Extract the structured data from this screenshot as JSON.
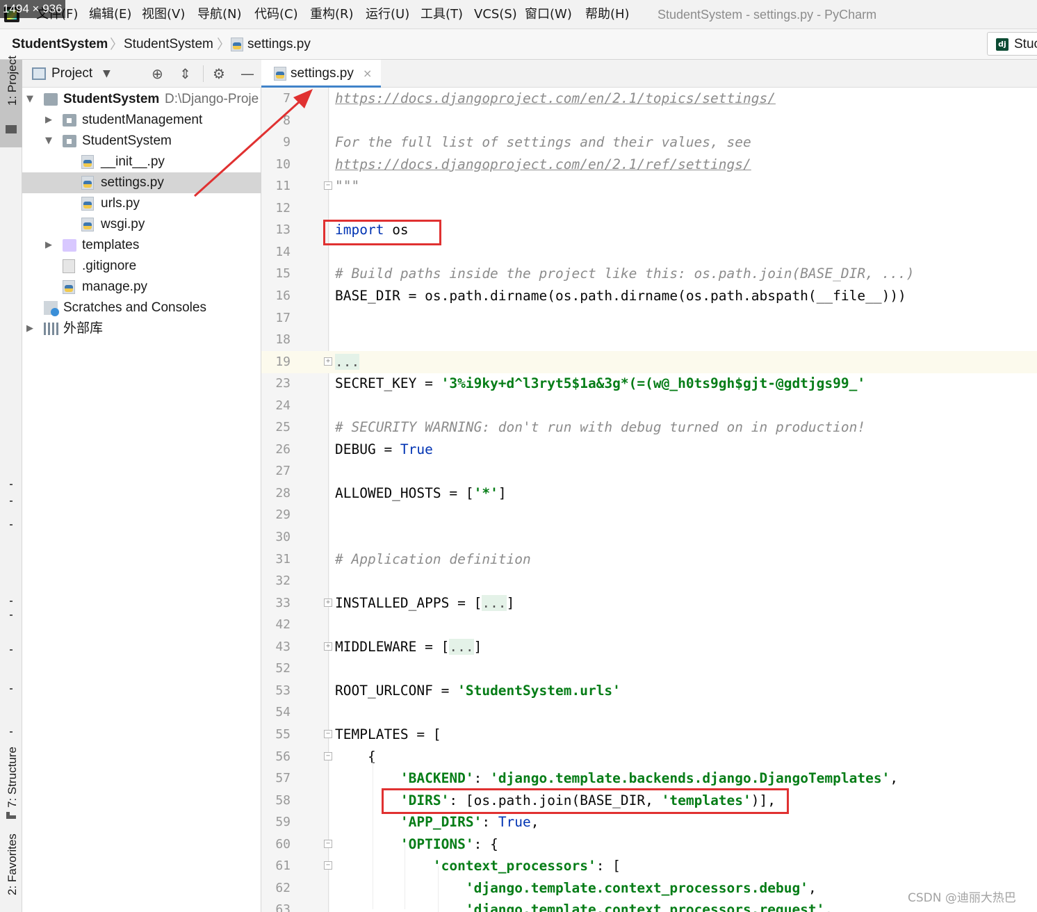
{
  "overlay": {
    "dimensions": "1494 × 936"
  },
  "menu": {
    "items": [
      "文件(F)",
      "编辑(E)",
      "视图(V)",
      "导航(N)",
      "代码(C)",
      "重构(R)",
      "运行(U)",
      "工具(T)",
      "VCS(S)",
      "窗口(W)",
      "帮助(H)"
    ],
    "window_title": "StudentSystem - settings.py - PyCharm"
  },
  "breadcrumb": {
    "items": [
      "StudentSystem",
      "StudentSystem",
      "settings.py"
    ],
    "run_config": "Stuc"
  },
  "tool_strip": {
    "project": "1: Project",
    "structure": "7: Structure",
    "favorites": "2: Favorites"
  },
  "project_panel": {
    "title": "Project",
    "tree": [
      {
        "label": "StudentSystem",
        "path": "D:\\Django-Proje",
        "depth": 0,
        "expanded": true,
        "icon": "folder-icon",
        "bold": true
      },
      {
        "label": "studentManagement",
        "depth": 1,
        "expanded": false,
        "icon": "module-folder-icon"
      },
      {
        "label": "StudentSystem",
        "depth": 1,
        "expanded": true,
        "icon": "module-folder-icon"
      },
      {
        "label": "__init__.py",
        "depth": 2,
        "icon": "python-file-icon"
      },
      {
        "label": "settings.py",
        "depth": 2,
        "icon": "python-file-icon",
        "selected": true
      },
      {
        "label": "urls.py",
        "depth": 2,
        "icon": "python-file-icon"
      },
      {
        "label": "wsgi.py",
        "depth": 2,
        "icon": "python-file-icon"
      },
      {
        "label": "templates",
        "depth": 1,
        "expanded": false,
        "icon": "templates-folder-icon"
      },
      {
        "label": ".gitignore",
        "depth": 1,
        "icon": "git-ignore-icon"
      },
      {
        "label": "manage.py",
        "depth": 1,
        "icon": "python-file-icon"
      },
      {
        "label": "Scratches and Consoles",
        "depth": 0,
        "icon": "scratches-icon"
      },
      {
        "label": "外部库",
        "depth": 0,
        "expanded": false,
        "icon": "library-icon"
      }
    ]
  },
  "editor": {
    "tab": {
      "label": "settings.py",
      "close": "×"
    },
    "current_line": "19",
    "lines": [
      {
        "n": "7",
        "fold": "",
        "tokens": [
          [
            "doclink",
            "https://docs.djangoproject.com/en/2.1/topics/settings/"
          ]
        ]
      },
      {
        "n": "8",
        "fold": "",
        "tokens": []
      },
      {
        "n": "9",
        "fold": "",
        "tokens": [
          [
            "doc",
            "For the full list of settings and their values, see"
          ]
        ]
      },
      {
        "n": "10",
        "fold": "",
        "tokens": [
          [
            "doclink",
            "https://docs.djangoproject.com/en/2.1/ref/settings/"
          ]
        ]
      },
      {
        "n": "11",
        "fold": "end",
        "tokens": [
          [
            "doc",
            "\"\"\""
          ]
        ]
      },
      {
        "n": "12",
        "fold": "",
        "tokens": []
      },
      {
        "n": "13",
        "fold": "",
        "tokens": [
          [
            "kw",
            "import"
          ],
          [
            "plain",
            " os"
          ]
        ]
      },
      {
        "n": "14",
        "fold": "",
        "tokens": []
      },
      {
        "n": "15",
        "fold": "",
        "tokens": [
          [
            "cmt",
            "# Build paths inside the project like this: os.path.join(BASE_DIR, ...)"
          ]
        ]
      },
      {
        "n": "16",
        "fold": "",
        "tokens": [
          [
            "plain",
            "BASE_DIR = os.path.dirname(os.path.dirname(os.path.abspath(__file__)))"
          ]
        ]
      },
      {
        "n": "17",
        "fold": "",
        "tokens": []
      },
      {
        "n": "18",
        "fold": "",
        "tokens": []
      },
      {
        "n": "19",
        "fold": "plus",
        "tokens": [
          [
            "fold",
            "..."
          ]
        ]
      },
      {
        "n": "23",
        "fold": "",
        "tokens": [
          [
            "plain",
            "SECRET_KEY = "
          ],
          [
            "str",
            "'3%i9ky+d^l3ryt5$1a&3g*(=(w@_h0ts9gh$gjt-@gdtjgs99_'"
          ]
        ]
      },
      {
        "n": "24",
        "fold": "",
        "tokens": []
      },
      {
        "n": "25",
        "fold": "",
        "tokens": [
          [
            "cmt",
            "# SECURITY WARNING: don't run with debug turned on in production!"
          ]
        ]
      },
      {
        "n": "26",
        "fold": "",
        "tokens": [
          [
            "plain",
            "DEBUG = "
          ],
          [
            "kw",
            "True"
          ]
        ]
      },
      {
        "n": "27",
        "fold": "",
        "tokens": []
      },
      {
        "n": "28",
        "fold": "",
        "tokens": [
          [
            "plain",
            "ALLOWED_HOSTS = ["
          ],
          [
            "str",
            "'*'"
          ],
          [
            "plain",
            "]"
          ]
        ]
      },
      {
        "n": "29",
        "fold": "",
        "tokens": []
      },
      {
        "n": "30",
        "fold": "",
        "tokens": []
      },
      {
        "n": "31",
        "fold": "",
        "tokens": [
          [
            "cmt",
            "# Application definition"
          ]
        ]
      },
      {
        "n": "32",
        "fold": "",
        "tokens": []
      },
      {
        "n": "33",
        "fold": "plus",
        "tokens": [
          [
            "plain",
            "INSTALLED_APPS = ["
          ],
          [
            "fold",
            "..."
          ],
          [
            "plain",
            "]"
          ]
        ]
      },
      {
        "n": "42",
        "fold": "",
        "tokens": []
      },
      {
        "n": "43",
        "fold": "plus",
        "tokens": [
          [
            "plain",
            "MIDDLEWARE = ["
          ],
          [
            "fold",
            "..."
          ],
          [
            "plain",
            "]"
          ]
        ]
      },
      {
        "n": "52",
        "fold": "",
        "tokens": []
      },
      {
        "n": "53",
        "fold": "",
        "tokens": [
          [
            "plain",
            "ROOT_URLCONF = "
          ],
          [
            "str",
            "'StudentSystem.urls'"
          ]
        ]
      },
      {
        "n": "54",
        "fold": "",
        "tokens": []
      },
      {
        "n": "55",
        "fold": "start",
        "tokens": [
          [
            "plain",
            "TEMPLATES = ["
          ]
        ]
      },
      {
        "n": "56",
        "fold": "start",
        "tokens": [
          [
            "plain",
            "    {"
          ]
        ]
      },
      {
        "n": "57",
        "fold": "",
        "tokens": [
          [
            "plain",
            "        "
          ],
          [
            "str",
            "'BACKEND'"
          ],
          [
            "plain",
            ": "
          ],
          [
            "str",
            "'django.template.backends.django.DjangoTemplates'"
          ],
          [
            "plain",
            ","
          ]
        ]
      },
      {
        "n": "58",
        "fold": "",
        "tokens": [
          [
            "plain",
            "        "
          ],
          [
            "str",
            "'DIRS'"
          ],
          [
            "plain",
            ": [os.path.join(BASE_DIR, "
          ],
          [
            "str",
            "'templates'"
          ],
          [
            "plain",
            ")],"
          ]
        ]
      },
      {
        "n": "59",
        "fold": "",
        "tokens": [
          [
            "plain",
            "        "
          ],
          [
            "str",
            "'APP_DIRS'"
          ],
          [
            "plain",
            ": "
          ],
          [
            "kw",
            "True"
          ],
          [
            "plain",
            ","
          ]
        ]
      },
      {
        "n": "60",
        "fold": "start",
        "tokens": [
          [
            "plain",
            "        "
          ],
          [
            "str",
            "'OPTIONS'"
          ],
          [
            "plain",
            ": {"
          ]
        ]
      },
      {
        "n": "61",
        "fold": "start",
        "tokens": [
          [
            "plain",
            "            "
          ],
          [
            "str",
            "'context_processors'"
          ],
          [
            "plain",
            ": ["
          ]
        ]
      },
      {
        "n": "62",
        "fold": "",
        "tokens": [
          [
            "plain",
            "                "
          ],
          [
            "str",
            "'django.template.context_processors.debug'"
          ],
          [
            "plain",
            ","
          ]
        ]
      },
      {
        "n": "63",
        "fold": "",
        "tokens": [
          [
            "plain",
            "                "
          ],
          [
            "str",
            "'django.template.context_processors.request'"
          ],
          [
            "plain",
            ","
          ]
        ]
      }
    ]
  },
  "watermark": "CSDN @迪丽大热巴",
  "colors": {
    "annotation": "#e03131",
    "keyword": "#0033b3",
    "string": "#067d17",
    "comment": "#8c8c8c"
  }
}
